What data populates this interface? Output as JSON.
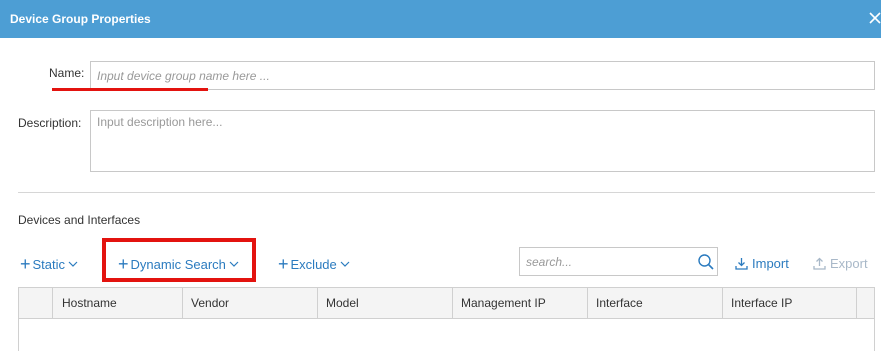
{
  "dialog": {
    "title": "Device Group Properties",
    "close_icon": "close-icon"
  },
  "form": {
    "name_label": "Name:",
    "name_placeholder": "Input device group name here ...",
    "description_label": "Description:",
    "description_placeholder": "Input description here..."
  },
  "devices": {
    "section_title": "Devices and Interfaces",
    "toolbar": {
      "static_label": "Static",
      "dynamic_search_label": "Dynamic Search",
      "exclude_label": "Exclude",
      "search_placeholder": "search...",
      "import_label": "Import",
      "export_label": "Export"
    },
    "columns": [
      "",
      "Hostname",
      "Vendor",
      "Model",
      "Management IP",
      "Interface",
      "Interface IP",
      ""
    ]
  },
  "colors": {
    "titlebar": "#4d9ed4",
    "link": "#2b7bbf",
    "highlight": "#e3130f",
    "disabled": "#a8b8c8"
  }
}
